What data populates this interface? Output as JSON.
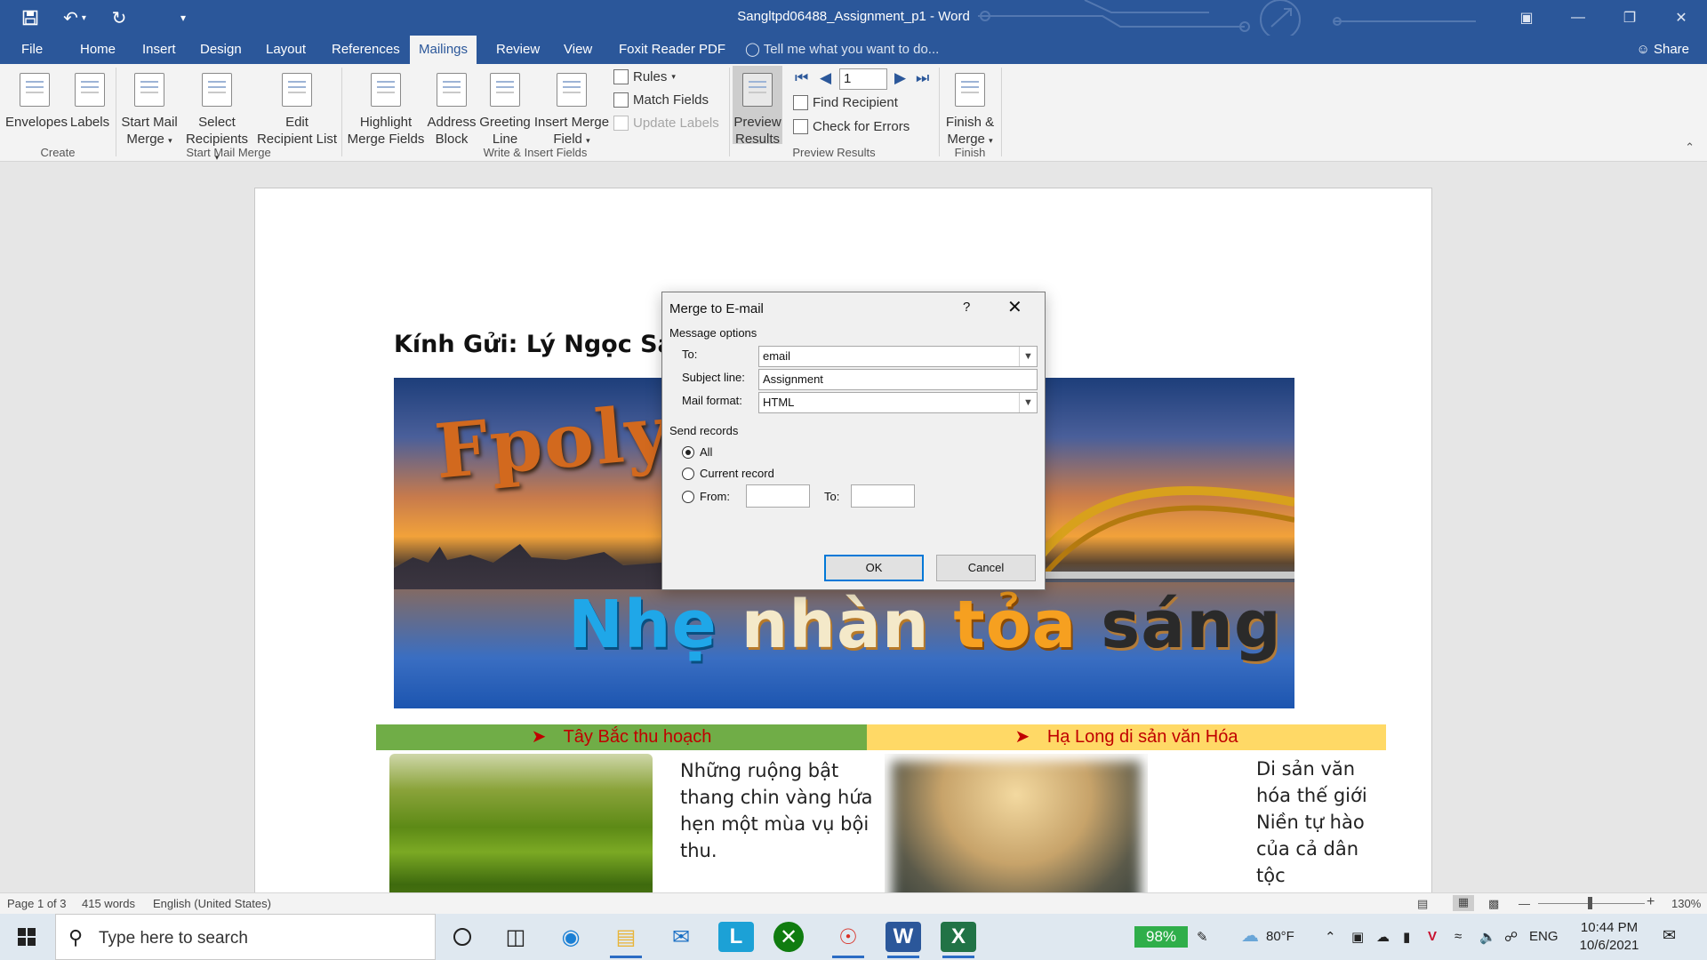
{
  "window": {
    "title": "Sangltpd06488_Assignment_p1 - Word"
  },
  "quick_access": {
    "save_icon": "save-icon",
    "undo_icon": "undo-icon",
    "redo_icon": "redo-icon",
    "customize_icon": "customize-icon"
  },
  "tabs": [
    "File",
    "Home",
    "Insert",
    "Design",
    "Layout",
    "References",
    "Mailings",
    "Review",
    "View",
    "Foxit Reader PDF"
  ],
  "active_tab": "Mailings",
  "tell_me": "Tell me what you want to do...",
  "share": "Share",
  "ribbon": {
    "create": {
      "label": "Create",
      "envelopes": "Envelopes",
      "labels": "Labels"
    },
    "start_mail_merge": {
      "label": "Start Mail Merge",
      "start_l1": "Start Mail",
      "start_l2": "Merge",
      "select_l1": "Select",
      "select_l2": "Recipients",
      "edit_l1": "Edit",
      "edit_l2": "Recipient List"
    },
    "write_insert": {
      "label": "Write & Insert Fields",
      "highlight_l1": "Highlight",
      "highlight_l2": "Merge Fields",
      "address_l1": "Address",
      "address_l2": "Block",
      "greeting_l1": "Greeting",
      "greeting_l2": "Line",
      "insert_l1": "Insert Merge",
      "insert_l2": "Field",
      "rules": "Rules",
      "match_fields": "Match Fields",
      "update_labels": "Update Labels"
    },
    "preview_results": {
      "label": "Preview Results",
      "preview_l1": "Preview",
      "preview_l2": "Results",
      "record": "1",
      "find_recipient": "Find Recipient",
      "check_errors": "Check for Errors"
    },
    "finish": {
      "label": "Finish",
      "finish_l1": "Finish &",
      "finish_l2": "Merge"
    }
  },
  "document": {
    "salutation": "Kính Gửi: Lý Ngọc Sang",
    "banner_text_1": "Fpoly T",
    "banner_word_1": "Nhẹ",
    "banner_word_2": "nhàn",
    "banner_word_3": "tỏa",
    "banner_word_4": "sáng",
    "section_left": "Tây Bắc thu hoạch",
    "section_right": "Hạ Long di sản văn Hóa",
    "para_left": [
      "Những ruộng bật",
      "thang chin vàng hứa",
      "hẹn một mùa vụ bội",
      "thu."
    ],
    "para_right": [
      "Di sản văn",
      "hóa thế giới",
      "Niền tự hào",
      "của cả dân",
      "tộc"
    ]
  },
  "dialog": {
    "title": "Merge to E-mail",
    "help": "?",
    "message_options": "Message options",
    "to_label": "To:",
    "to_value": "email",
    "subject_label": "Subject line:",
    "subject_value": "Assignment",
    "format_label": "Mail format:",
    "format_value": "HTML",
    "send_records": "Send records",
    "all": "All",
    "current": "Current record",
    "from": "From:",
    "to2": "To:",
    "ok": "OK",
    "cancel": "Cancel"
  },
  "status": {
    "page": "Page 1 of 3",
    "words": "415 words",
    "language": "English (United States)",
    "zoom": "130%"
  },
  "taskbar": {
    "search_placeholder": "Type here to search",
    "battery": "98%",
    "temperature": "80°F",
    "lang": "ENG",
    "time": "10:44 PM",
    "date": "10/6/2021"
  },
  "colors": {
    "word_blue": "#2b579a",
    "bar_left": "#70ad47",
    "bar_right": "#ffd966",
    "heading_red": "#c00000"
  }
}
